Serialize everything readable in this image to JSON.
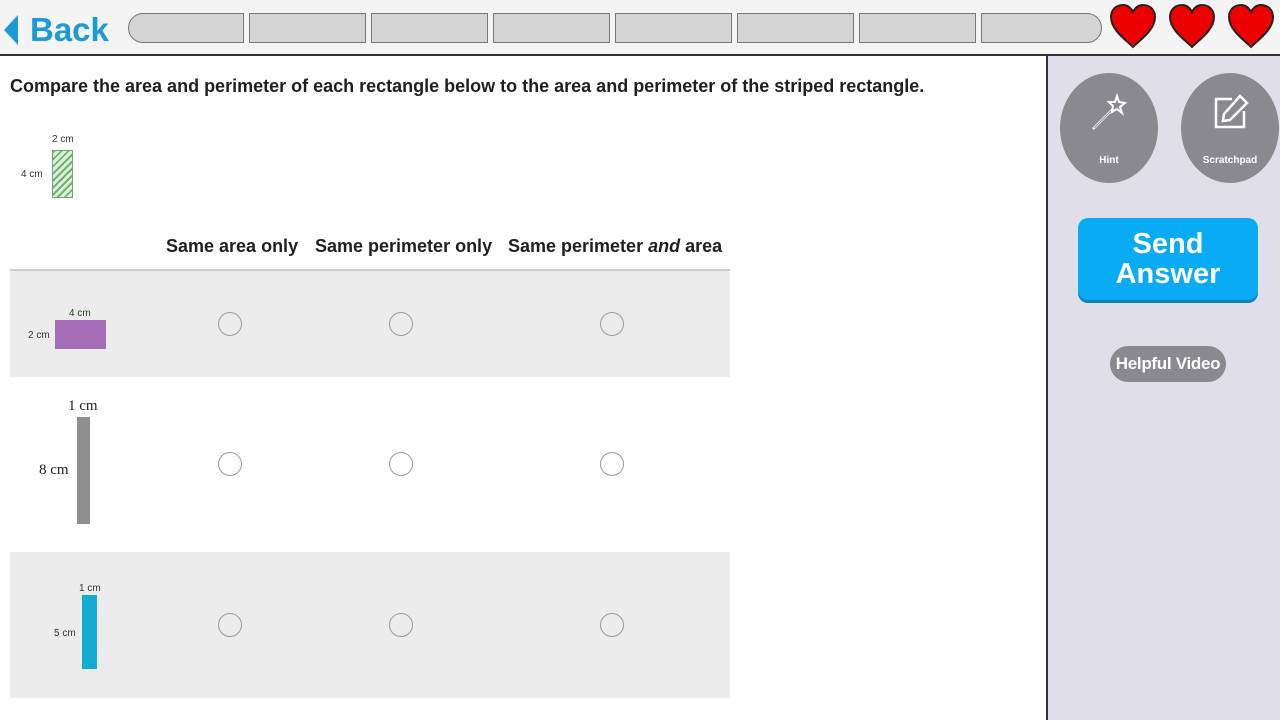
{
  "header": {
    "back_label": "Back",
    "progress_segments": 8,
    "lives": 3,
    "heart_color": "#ee0000",
    "accent": "#1a9bd7"
  },
  "question": {
    "text": "Compare the area and perimeter of each rectangle below to the area and perimeter of the striped rectangle.",
    "reference": {
      "width_label": "2 cm",
      "height_label": "4 cm"
    }
  },
  "table": {
    "columns": [
      {
        "label": "Same area only"
      },
      {
        "label": "Same perimeter only"
      },
      {
        "label_before": "Same perimeter ",
        "label_em": "and",
        "label_after": " area"
      }
    ],
    "rows": [
      {
        "width_label": "4 cm",
        "height_label": "2 cm",
        "color": "#a56db5"
      },
      {
        "width_label": "1 cm",
        "height_label": "8 cm",
        "color": "#8f8f8f"
      },
      {
        "width_label": "1 cm",
        "height_label": "5 cm",
        "color": "#13abcf"
      }
    ]
  },
  "sidebar": {
    "hint_label": "Hint",
    "scratchpad_label": "Scratchpad",
    "send_line1": "Send",
    "send_line2": "Answer",
    "video_label": "Helpful Video"
  }
}
